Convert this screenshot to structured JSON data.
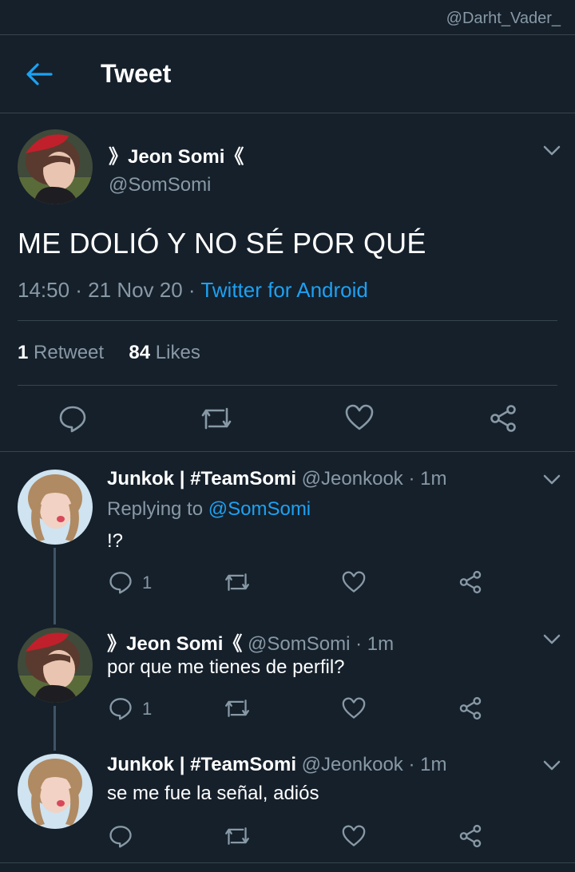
{
  "watermark": "@Darht_Vader_",
  "header": {
    "title": "Tweet"
  },
  "main_tweet": {
    "name": "》Jeon Somi《",
    "handle": "@SomSomi",
    "text": "ME DOLIÓ Y NO SÉ POR QUÉ",
    "time": "14:50 · 21 Nov 20 · ",
    "source": "Twitter for Android",
    "retweets": "1",
    "retweets_label": " Retweet",
    "likes": "84",
    "likes_label": " Likes"
  },
  "replies": [
    {
      "name": "Junkok | #TeamSomi",
      "handle": " @Jeonkook · 1m",
      "replying_prefix": "Replying to ",
      "replying_to": "@SomSomi",
      "text": "!?",
      "reply_count": "1"
    },
    {
      "name": "》Jeon Somi《",
      "handle": " @SomSomi · 1m",
      "text": "por que me tienes de perfil?",
      "reply_count": "1"
    },
    {
      "name": "Junkok | #TeamSomi",
      "handle": " @Jeonkook · 1m",
      "text": "se me fue la señal, adiós",
      "reply_count": ""
    }
  ],
  "colors": {
    "background": "#15202b",
    "accent": "#1da1f2",
    "muted": "#8899a6",
    "divider": "#38444d"
  },
  "icons": [
    "back-arrow-icon",
    "chevron-down-icon",
    "reply-icon",
    "retweet-icon",
    "like-icon",
    "share-icon"
  ]
}
